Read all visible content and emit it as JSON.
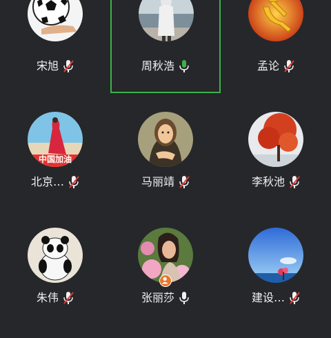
{
  "participants": [
    {
      "name": "宋旭",
      "mic": "muted",
      "avatar": "soccer-ball-avatar"
    },
    {
      "name": "周秋浩",
      "mic": "on",
      "avatar": "hooded-figure-sea-avatar",
      "speaking": true
    },
    {
      "name": "孟论",
      "mic": "muted",
      "avatar": "party-emblem-avatar"
    },
    {
      "name": "北京…",
      "mic": "muted",
      "avatar": "red-dress-beach-avatar",
      "caption": "中国加油"
    },
    {
      "name": "马丽靖",
      "mic": "muted",
      "avatar": "mona-lisa-avatar"
    },
    {
      "name": "李秋池",
      "mic": "muted",
      "avatar": "red-autumn-tree-avatar"
    },
    {
      "name": "朱伟",
      "mic": "muted",
      "avatar": "panda-avatar"
    },
    {
      "name": "张丽莎",
      "mic": "on",
      "avatar": "woman-flowers-avatar",
      "host_badge": true
    },
    {
      "name": "建设…",
      "mic": "muted",
      "avatar": "blue-sky-sea-avatar"
    }
  ],
  "colors": {
    "background": "#26272b",
    "speaking_border": "#3bb34a",
    "mic_on": "#3bb34a",
    "mic_muted_slash": "#e53935",
    "host_badge": "#e9762b"
  }
}
